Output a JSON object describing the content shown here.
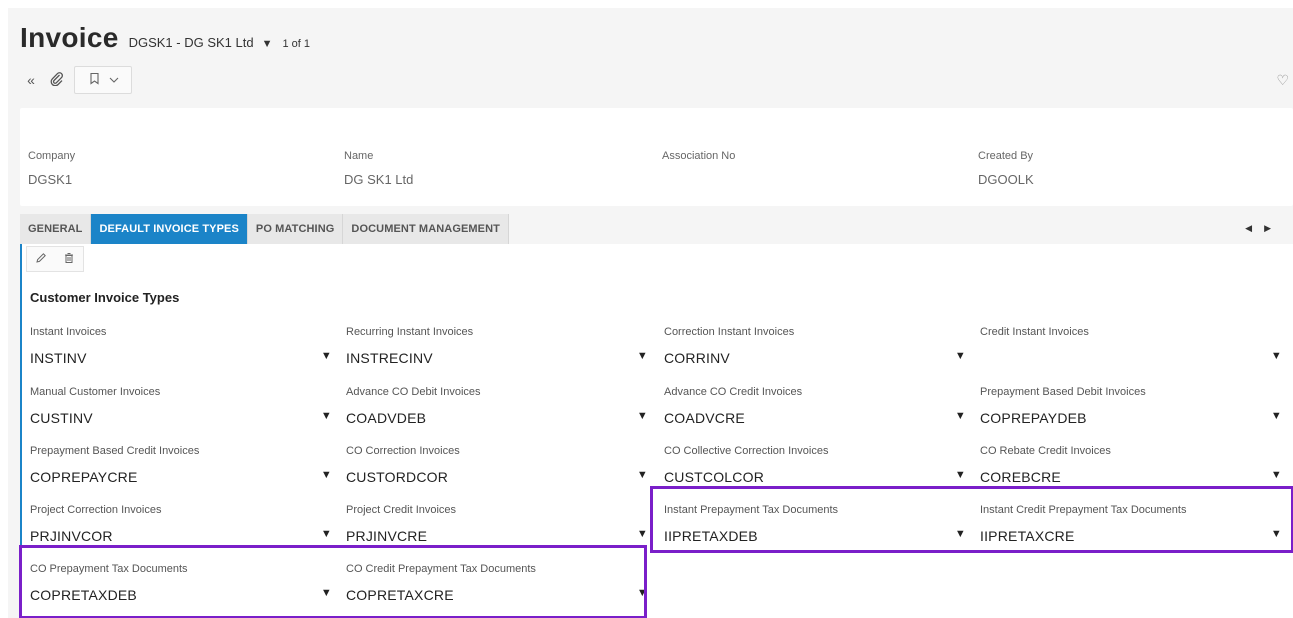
{
  "header": {
    "title": "Invoice",
    "record": "DGSK1 - DG SK1 Ltd",
    "record_count": "1 of 1"
  },
  "toolbar": {
    "icons": [
      "double-chevron-left-icon",
      "paperclip-icon",
      "bookmark-icon",
      "chevron-down-icon",
      "heart-icon"
    ]
  },
  "header_fields": [
    {
      "label": "Company",
      "value": "DGSK1"
    },
    {
      "label": "Name",
      "value": "DG  SK1 Ltd"
    },
    {
      "label": "Association No",
      "value": ""
    },
    {
      "label": "Created By",
      "value": "DGOOLK"
    }
  ],
  "tabs": [
    {
      "label": "GENERAL",
      "active": false
    },
    {
      "label": "DEFAULT INVOICE TYPES",
      "active": true
    },
    {
      "label": "PO MATCHING",
      "active": false
    },
    {
      "label": "DOCUMENT MANAGEMENT",
      "active": false
    }
  ],
  "section": {
    "title": "Customer Invoice Types"
  },
  "fields": [
    {
      "label": "Instant Invoices",
      "value": "INSTINV"
    },
    {
      "label": "Recurring Instant Invoices",
      "value": "INSTRECINV"
    },
    {
      "label": "Correction Instant Invoices",
      "value": "CORRINV"
    },
    {
      "label": "Credit Instant Invoices",
      "value": ""
    },
    {
      "label": "Manual Customer Invoices",
      "value": "CUSTINV"
    },
    {
      "label": "Advance CO Debit Invoices",
      "value": "COADVDEB"
    },
    {
      "label": "Advance CO Credit Invoices",
      "value": "COADVCRE"
    },
    {
      "label": "Prepayment Based Debit Invoices",
      "value": "COPREPAYDEB"
    },
    {
      "label": "Prepayment Based Credit Invoices",
      "value": "COPREPAYCRE"
    },
    {
      "label": "CO Correction Invoices",
      "value": "CUSTORDCOR"
    },
    {
      "label": "CO Collective Correction Invoices",
      "value": "CUSTCOLCOR"
    },
    {
      "label": "CO Rebate Credit Invoices",
      "value": "COREBCRE"
    },
    {
      "label": "Project Correction Invoices",
      "value": "PRJINVCOR"
    },
    {
      "label": "Project Credit Invoices",
      "value": "PRJINVCRE"
    },
    {
      "label": "Instant Prepayment Tax Documents",
      "value": "IIPRETAXDEB"
    },
    {
      "label": "Instant Credit Prepayment Tax Documents",
      "value": "IIPRETAXCRE"
    },
    {
      "label": "CO Prepayment Tax Documents",
      "value": "COPRETAXDEB"
    },
    {
      "label": "CO Credit Prepayment Tax Documents",
      "value": "COPRETAXCRE"
    }
  ],
  "colors": {
    "accent": "#1b84c8",
    "highlight": "#7a1fc9"
  }
}
